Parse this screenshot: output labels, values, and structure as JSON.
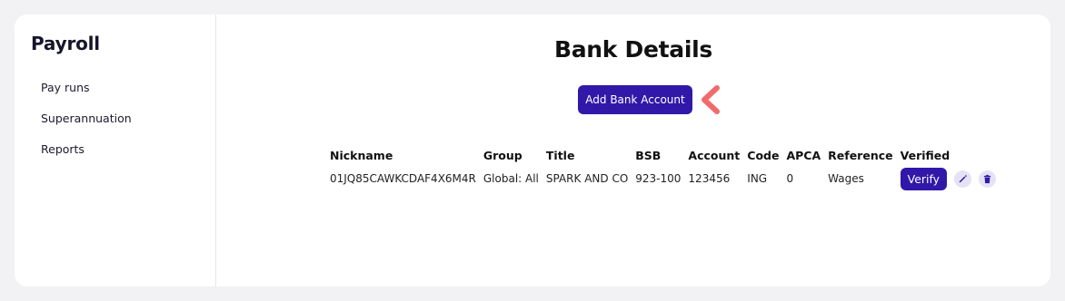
{
  "sidebar": {
    "title": "Payroll",
    "items": [
      {
        "label": "Pay runs"
      },
      {
        "label": "Superannuation"
      },
      {
        "label": "Reports"
      }
    ]
  },
  "main": {
    "title": "Bank Details",
    "add_button_label": "Add Bank Account",
    "table": {
      "headers": [
        "Nickname",
        "Group",
        "Title",
        "BSB",
        "Account",
        "Code",
        "APCA",
        "Reference",
        "Verified"
      ],
      "rows": [
        {
          "nickname": "01JQ85CAWKCDAF4X6M4R",
          "group": "Global: All",
          "title": "SPARK AND CO",
          "bsb": "923-100",
          "account": "123456",
          "code": "ING",
          "apca": "0",
          "reference": "Wages",
          "verify_label": "Verify"
        }
      ]
    }
  },
  "colors": {
    "accent": "#3118a8",
    "icon_bg": "#e5e2f5",
    "pointer": "#f26b6b"
  },
  "icons": {
    "edit": "pencil-icon",
    "delete": "trash-icon"
  }
}
